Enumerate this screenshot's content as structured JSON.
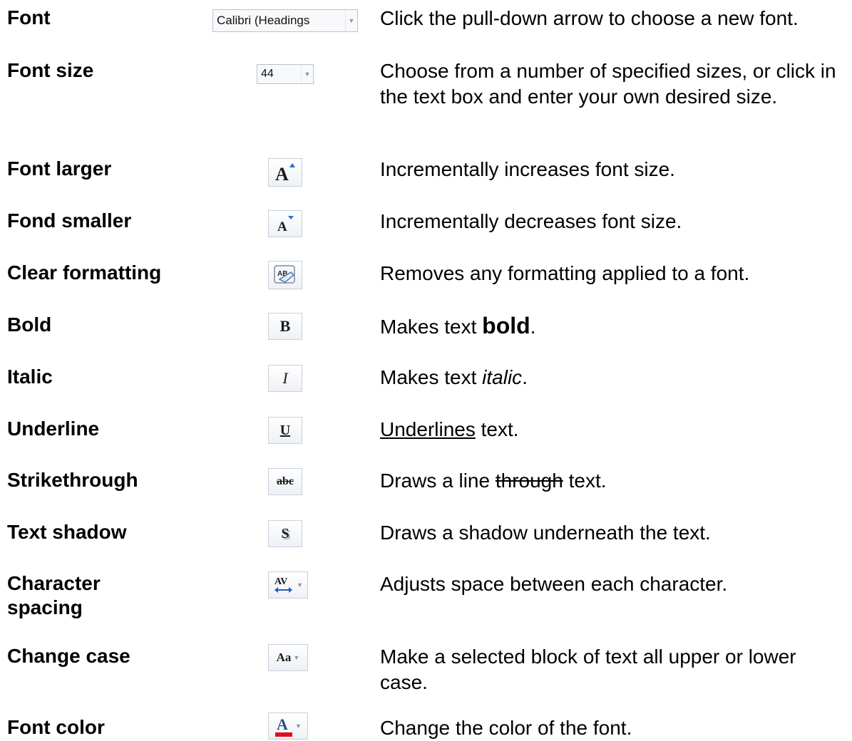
{
  "rows": [
    {
      "label": "Font",
      "control": {
        "type": "combo",
        "value": "Calibri (Headings",
        "icon": "chevron-down-icon"
      },
      "desc": "Click the pull-down arrow to choose a new font."
    },
    {
      "label": "Font size",
      "control": {
        "type": "combo",
        "value": "44",
        "icon": "chevron-down-icon"
      },
      "desc": "Choose from a number of specified sizes, or click in the text box and enter your own desired size."
    },
    {
      "label": "Font larger",
      "control": {
        "type": "button",
        "icon": "grow-font-icon",
        "glyph": "A"
      },
      "desc": "Incrementally increases font size."
    },
    {
      "label": "Fond smaller",
      "control": {
        "type": "button",
        "icon": "shrink-font-icon",
        "glyph": "A"
      },
      "desc": "Incrementally decreases font size."
    },
    {
      "label": "Clear formatting",
      "control": {
        "type": "button",
        "icon": "clear-formatting-icon",
        "glyph": "AB"
      },
      "desc": "Removes any formatting applied to a font."
    },
    {
      "label": "Bold",
      "control": {
        "type": "button",
        "icon": "bold-icon",
        "glyph": "B"
      },
      "desc": {
        "before": "Makes text ",
        "emph": "bold",
        "after": "."
      }
    },
    {
      "label": "Italic",
      "control": {
        "type": "button",
        "icon": "italic-icon",
        "glyph": "I"
      },
      "desc": {
        "before": "Makes text ",
        "emph": "italic",
        "after": "."
      }
    },
    {
      "label": "Underline",
      "control": {
        "type": "button",
        "icon": "underline-icon",
        "glyph": "U"
      },
      "desc": {
        "before": "",
        "emph": "Underlines",
        "after": " text."
      }
    },
    {
      "label": "Strikethrough",
      "control": {
        "type": "button",
        "icon": "strikethrough-icon",
        "glyph": "abc"
      },
      "desc": {
        "before": "Draws a line ",
        "emph": "through",
        "after": " text."
      }
    },
    {
      "label": "Text shadow",
      "control": {
        "type": "button",
        "icon": "text-shadow-icon",
        "glyph": "S"
      },
      "desc": "Draws a shadow underneath the text."
    },
    {
      "label": "Character spacing",
      "control": {
        "type": "split",
        "icon": "character-spacing-icon",
        "glyph": "AV"
      },
      "desc": "Adjusts space between each character."
    },
    {
      "label": "Change case",
      "control": {
        "type": "split",
        "icon": "change-case-icon",
        "glyph": "Aa"
      },
      "desc": "Make a selected block of text all upper or lower case."
    },
    {
      "label": "Font color",
      "control": {
        "type": "split",
        "icon": "font-color-icon",
        "glyph": "A"
      },
      "desc": "Change the color of the font."
    }
  ],
  "colors": {
    "font_color_bar": "#e0101a",
    "spacing_arrow": "#1f5fbf",
    "grow_arrow": "#2a6fd1"
  }
}
